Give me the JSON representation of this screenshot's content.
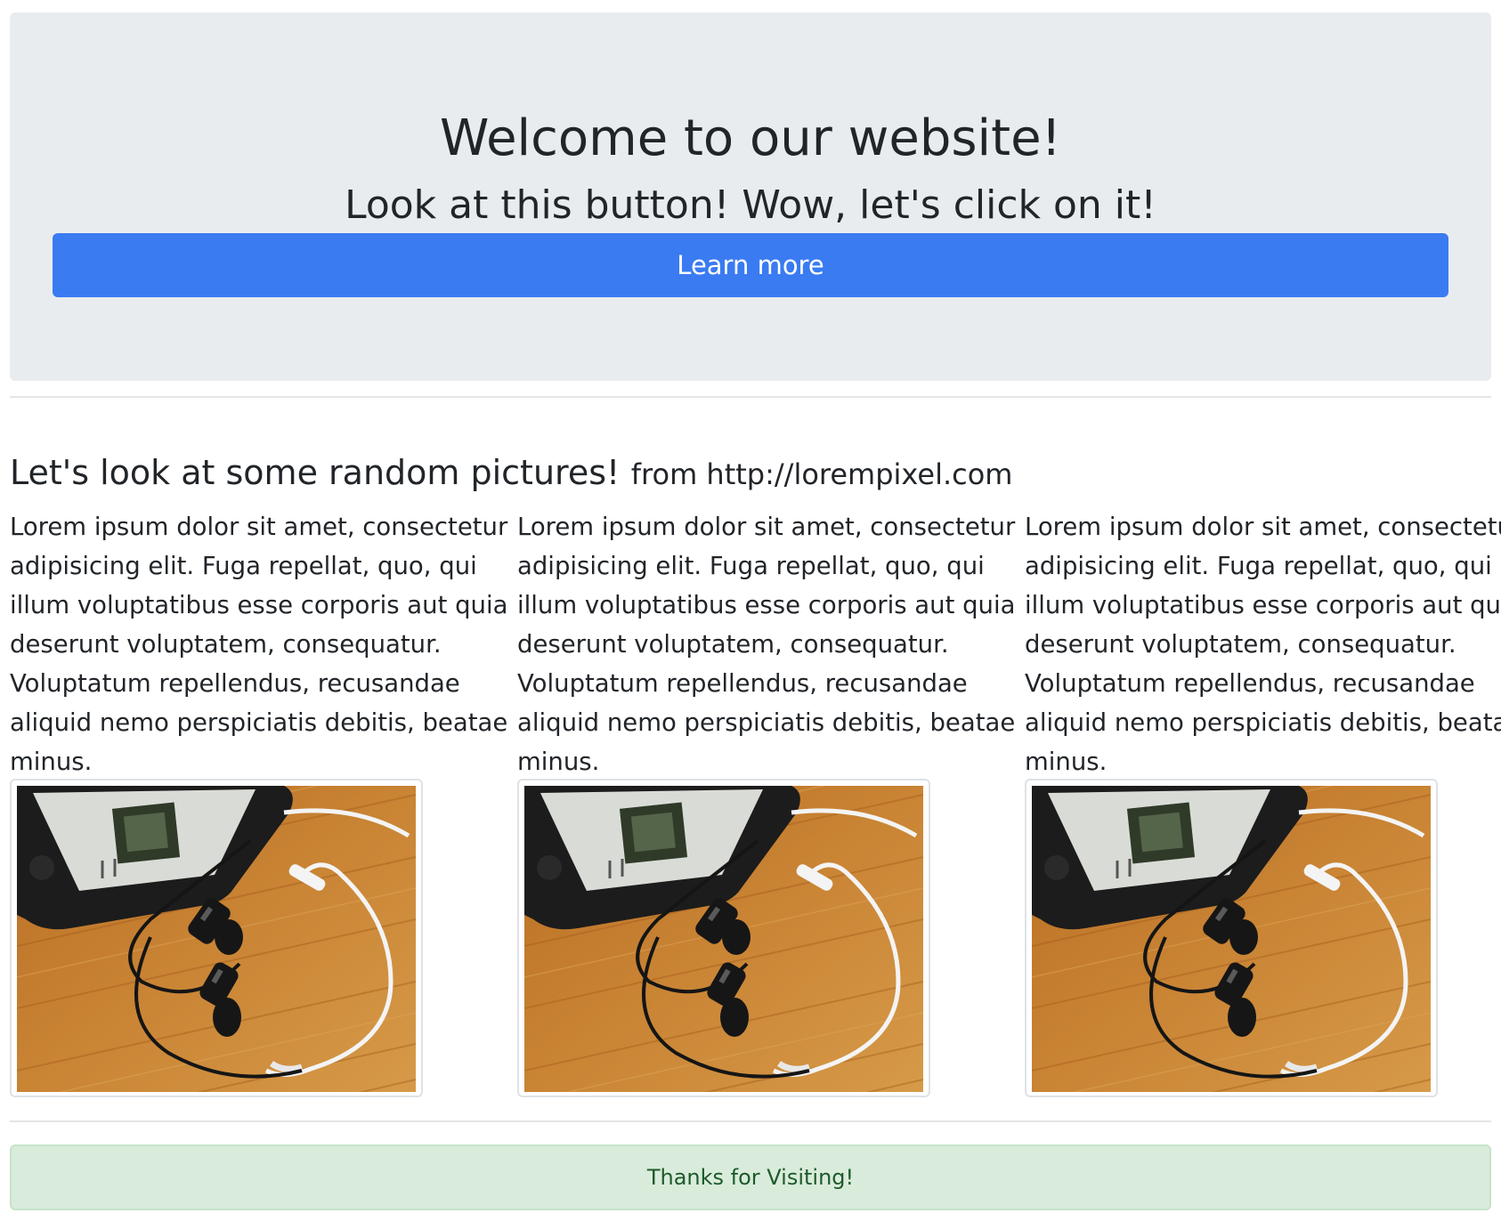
{
  "jumbotron": {
    "title": "Welcome to our website!",
    "subtitle": "Look at this button! Wow, let's click on it!",
    "button_label": "Learn more"
  },
  "gallery": {
    "heading": "Let's look at some random pictures!",
    "heading_small": "from http://lorempixel.com",
    "columns": [
      {
        "text": "Lorem ipsum dolor sit amet, consectetur adipisicing elit. Fuga repellat, quo, qui illum voluptatibus esse corporis aut quia deserunt voluptatem, consequatur. Voluptatum repellendus, recusandae aliquid nemo perspiciatis debitis, beatae minus.",
        "image": "phone-and-earphones-photo"
      },
      {
        "text": "Lorem ipsum dolor sit amet, consectetur adipisicing elit. Fuga repellat, quo, qui illum voluptatibus esse corporis aut quia deserunt voluptatem, consequatur. Voluptatum repellendus, recusandae aliquid nemo perspiciatis debitis, beatae minus.",
        "image": "phone-and-earphones-photo"
      },
      {
        "text": "Lorem ipsum dolor sit amet, consectetur adipisicing elit. Fuga repellat, quo, qui illum voluptatibus esse corporis aut quia deserunt voluptatem, consequatur. Voluptatum repellendus, recusandae aliquid nemo perspiciatis debitis, beatae minus.",
        "image": "phone-and-earphones-photo"
      }
    ]
  },
  "footer": {
    "message": "Thanks for Visiting!"
  },
  "colors": {
    "primary": "#3a7bf2",
    "jumbotron_bg": "#e9ecef",
    "success_bg": "#d9ecdb",
    "success_text": "#1e5a2b"
  }
}
